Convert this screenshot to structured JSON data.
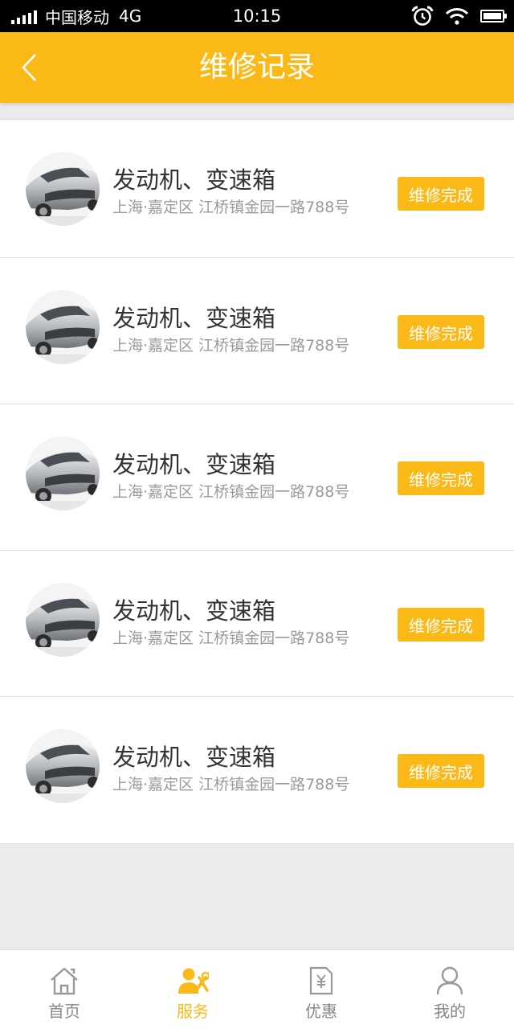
{
  "status_bar": {
    "carrier": "中国移动",
    "network": "4G",
    "time": "10:15"
  },
  "header": {
    "title": "维修记录",
    "back_icon": "chevron-left-icon"
  },
  "records": [
    {
      "title": "发动机、变速箱",
      "address": "上海·嘉定区 江桥镇金园一路788号",
      "status": "维修完成"
    },
    {
      "title": "发动机、变速箱",
      "address": "上海·嘉定区 江桥镇金园一路788号",
      "status": "维修完成"
    },
    {
      "title": "发动机、变速箱",
      "address": "上海·嘉定区 江桥镇金园一路788号",
      "status": "维修完成"
    },
    {
      "title": "发动机、变速箱",
      "address": "上海·嘉定区 江桥镇金园一路788号",
      "status": "维修完成"
    },
    {
      "title": "发动机、变速箱",
      "address": "上海·嘉定区 江桥镇金园一路788号",
      "status": "维修完成"
    }
  ],
  "tabs": [
    {
      "label": "首页",
      "icon": "home-icon",
      "active": false
    },
    {
      "label": "服务",
      "icon": "service-icon",
      "active": true
    },
    {
      "label": "优惠",
      "icon": "coupon-icon",
      "active": false
    },
    {
      "label": "我的",
      "icon": "user-icon",
      "active": false
    }
  ],
  "colors": {
    "accent": "#fbb917",
    "background": "#ebebeb"
  }
}
